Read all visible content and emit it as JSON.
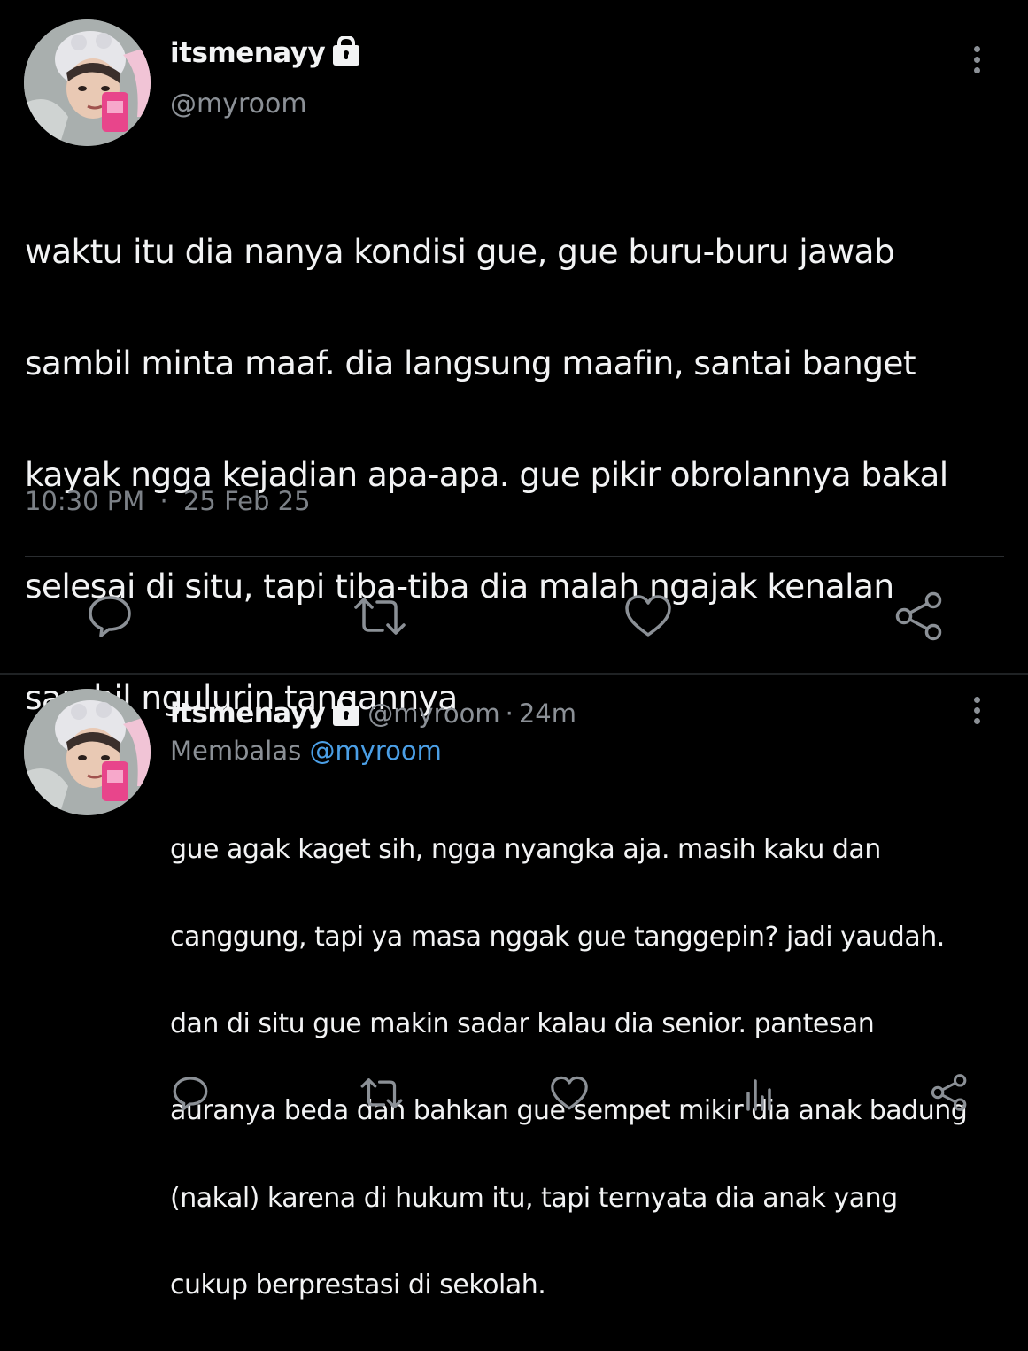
{
  "main_tweet": {
    "author": {
      "name": "itsmenayy",
      "handle": "@myroom",
      "locked_icon": "lock-icon",
      "avatar_icon": "profile-photo"
    },
    "text_lines": [
      "waktu itu dia nanya kondisi gue, gue buru-buru jawab",
      "sambil minta maaf. dia langsung maafin, santai banget",
      "kayak ngga kejadian apa-apa. gue pikir obrolannya bakal",
      "selesai di situ, tapi tiba-tiba dia malah ngajak kenalan",
      "sambil ngulurin tangannya"
    ],
    "time": "10:30 PM",
    "separator": "·",
    "date": "25 Feb 25",
    "actions": [
      "reply-icon",
      "retweet-icon",
      "like-icon",
      "share-icon"
    ]
  },
  "reply_tweet": {
    "author": {
      "name": "itsmenayy",
      "handle": "@myroom",
      "separator": "·",
      "age": "24m",
      "locked_icon": "lock-icon",
      "avatar_icon": "profile-photo"
    },
    "replying_prefix": "Membalas",
    "replying_to": "@myroom",
    "text_lines": [
      "gue agak kaget sih, ngga nyangka aja. masih kaku dan",
      "canggung, tapi ya masa nggak gue tanggepin? jadi yaudah.",
      "dan di situ gue makin sadar kalau dia senior. pantesan",
      "auranya beda dan bahkan gue sempet mikir dia anak badung",
      "(nakal) karena di hukum itu, tapi ternyata dia anak yang",
      "cukup berprestasi di sekolah."
    ],
    "actions": [
      "reply-icon",
      "retweet-icon",
      "like-icon",
      "views-icon",
      "share-icon"
    ]
  },
  "colors": {
    "background": "#000000",
    "text": "#f2f3f4",
    "secondary": "#8b9096",
    "link": "#4b9fe6",
    "divider": "#2a2d30"
  }
}
